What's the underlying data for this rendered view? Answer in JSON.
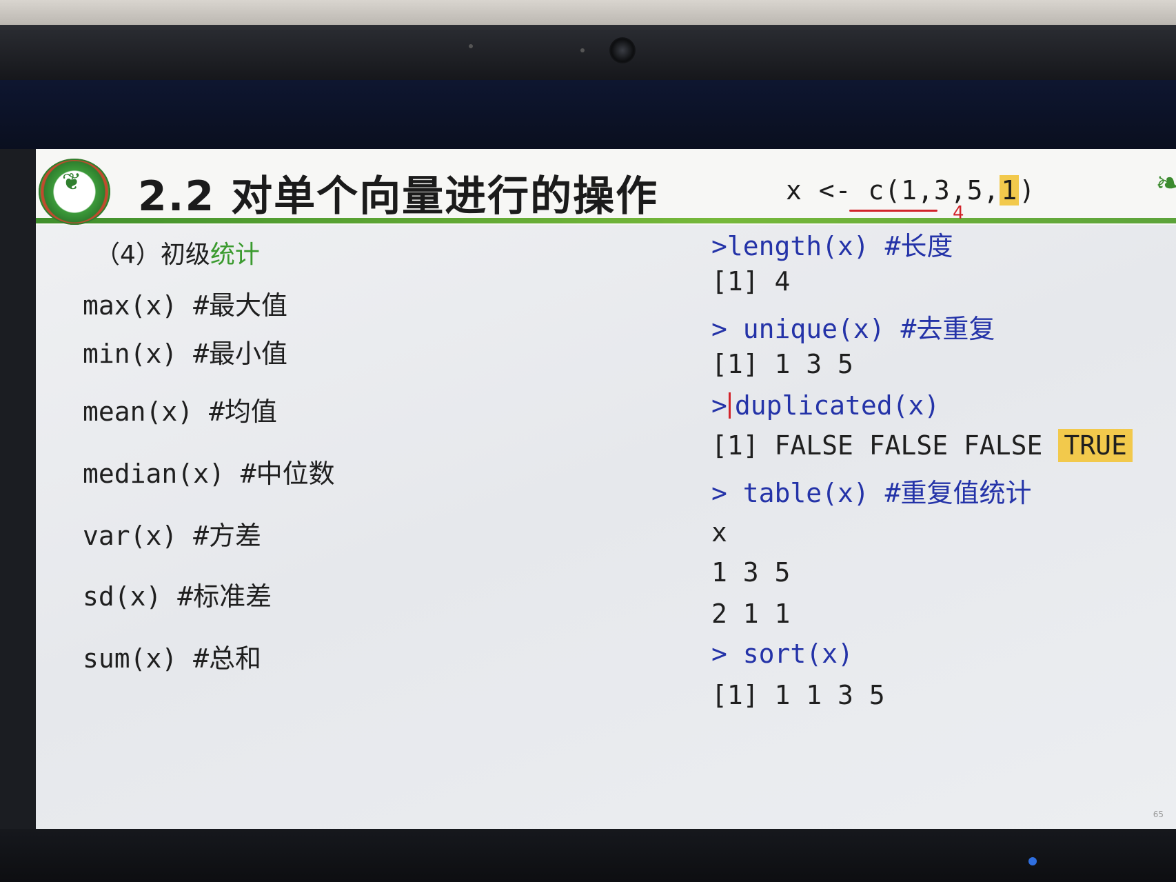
{
  "browser_links": [
    "",
    "",
    ""
  ],
  "slide": {
    "title": "2.2 对单个向量进行的操作",
    "vector_def": {
      "prefix": "x <- c(1,3,5,",
      "highlight": "1",
      "suffix": ")"
    },
    "annotation_mark": "4",
    "section": {
      "prefix": "（4）初级",
      "green_part": "统计"
    },
    "functions": [
      "max(x) #最大值",
      "min(x) #最小值",
      "mean(x) #均值",
      "median(x) #中位数",
      "var(x) #方差",
      "sd(x) #标准差",
      "sum(x) #总和"
    ],
    "console": {
      "line1_cmd": ">length(x) #长度",
      "line2_out": "[1] 4",
      "line3_cmd": "> unique(x) #去重复",
      "line4_out": "[1] 1 3 5",
      "line5_prompt": ">",
      "line5_cmd": "duplicated(x)",
      "line6_out": "[1] FALSE FALSE FALSE ",
      "line6_true": "TRUE",
      "line7_cmd": "> table(x) #重复值统计",
      "line8_out": "x",
      "line9_out": "1 3 5",
      "line10_out": "2 1 1",
      "line11_cmd": "> sort(x)",
      "line12_out": "[1] 1 1 3 5"
    },
    "page_number": "65"
  },
  "colors": {
    "command_blue": "#2433a8",
    "highlight_yellow": "#f2c94c",
    "accent_green": "#3a9a2e",
    "annotation_red": "#d2232a"
  }
}
